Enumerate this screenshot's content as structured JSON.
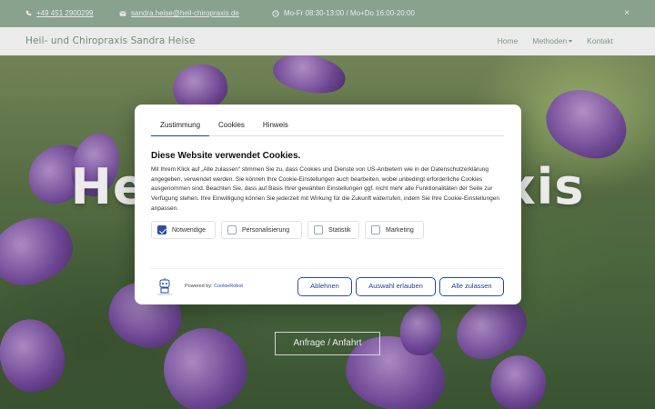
{
  "topbar": {
    "phone": "+49 451 2900299",
    "email": "sandra.heise@heil-chiropraxis.de",
    "hours": "Mo-Fr 08:30-13:00 / Mo+Do 16:00-20:00",
    "close": "×"
  },
  "nav": {
    "brand": "Heil- und Chiropraxis Sandra Heise",
    "links": [
      "Home",
      "Methoden",
      "Kontakt"
    ]
  },
  "hero": {
    "title_left": "He",
    "title_right": "axis",
    "button": "Anfrage / Anfahrt"
  },
  "cookie": {
    "tabs": [
      "Zustimmung",
      "Cookies",
      "Hinweis"
    ],
    "title": "Diese Website verwendet Cookies.",
    "text": "Mit Ihrem Klick auf „Alle zulassen“ stimmen Sie zu, dass Cookies und Dienste von US-Anbietern wie in der Datenschutzerklärung angegeben, verwendet werden. Sie können Ihre Cookie-Einstellungen auch bearbeiten, wobei unbedingt erforderliche Cookies ausgenommen sind. Beachten Sie, dass auf Basis Ihrer gewählten Einstellungen ggf. nicht mehr alle Funktionalitäten der Seite zur Verfügung stehen. Ihre Einwilligung können Sie jederzeit mit Wirkung für die Zukunft widerrufen, indem Sie Ihre Cookie-Einstellungen anpassen.",
    "checkboxes": [
      {
        "label": "Notwendige",
        "checked": true
      },
      {
        "label": "Personalisierung",
        "checked": false
      },
      {
        "label": "Statistik",
        "checked": false
      },
      {
        "label": "Marketing",
        "checked": false
      }
    ],
    "powered_prefix": "Powered by:",
    "powered_link": "CookieRobot",
    "buttons": {
      "decline": "Ablehnen",
      "allow_selection": "Auswahl erlauben",
      "allow_all": "Alle zulassen"
    },
    "accent_color": "#2a4ea0"
  },
  "colors": {
    "topbar_bg": "#94b09a",
    "brand_text": "#7a9a84"
  }
}
